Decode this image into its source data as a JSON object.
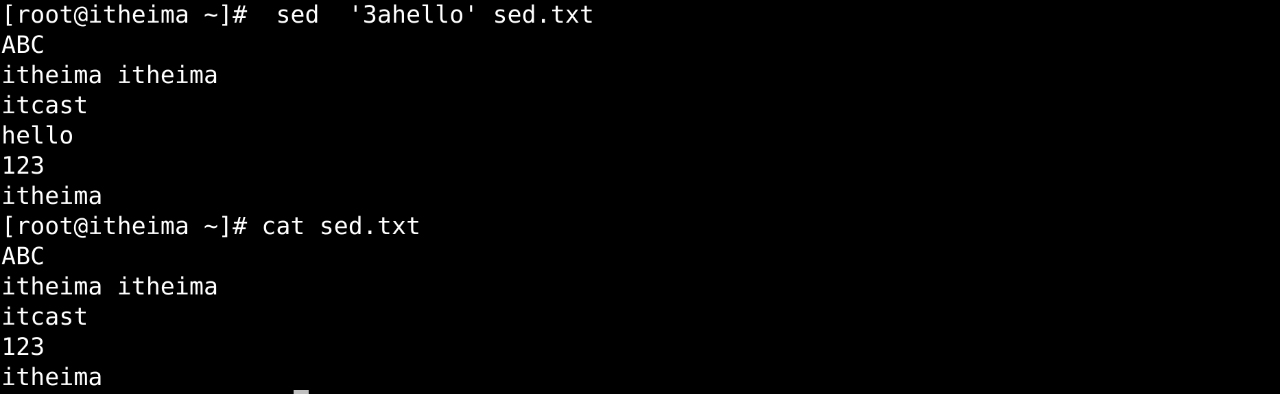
{
  "terminal": {
    "lines": [
      "[root@itheima ~]#  sed  '3ahello' sed.txt",
      "ABC",
      "itheima itheima",
      "itcast",
      "hello",
      "123",
      "itheima",
      "[root@itheima ~]# cat sed.txt",
      "ABC",
      "itheima itheima",
      "itcast",
      "123",
      "itheima"
    ],
    "colors": {
      "background": "#000000",
      "foreground": "#ffffff",
      "cursor": "#bfbfbf"
    }
  }
}
